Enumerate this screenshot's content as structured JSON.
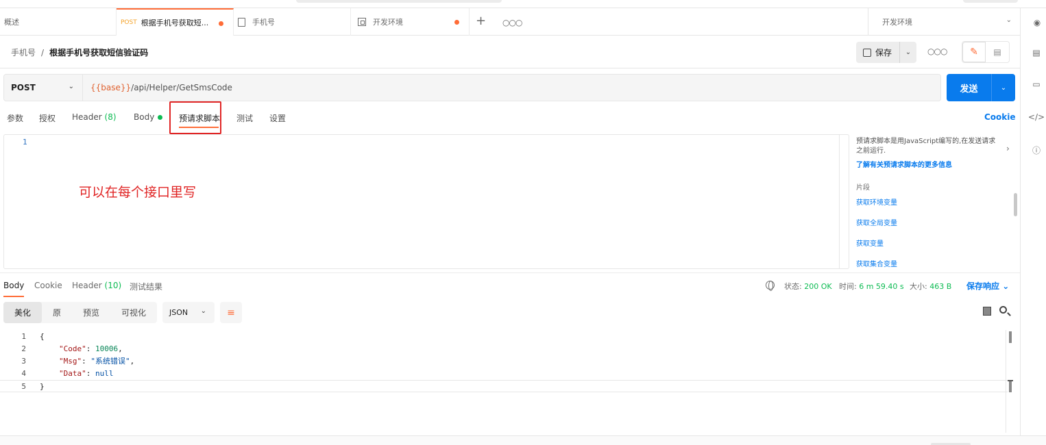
{
  "tabs": [
    {
      "label": "概述"
    },
    {
      "method": "POST",
      "label": "根据手机号获取短...",
      "unsaved": true
    },
    {
      "label": "手机号"
    },
    {
      "label": "开发环境",
      "unsaved": true
    }
  ],
  "environment": {
    "selected": "开发环境"
  },
  "breadcrumb": {
    "parent": "手机号",
    "separator": "/",
    "current": "根据手机号获取短信验证码"
  },
  "toolbar": {
    "save_label": "保存"
  },
  "request": {
    "method": "POST",
    "url_variable": "{{base}}",
    "url_path": "/api/Helper/GetSmsCode",
    "send_label": "发送"
  },
  "request_tabs": {
    "params": "参数",
    "auth": "授权",
    "headers": "Header",
    "headers_count": "(8)",
    "body": "Body",
    "prerequest": "预请求脚本",
    "tests": "测试",
    "settings": "设置",
    "cookie": "Cookie",
    "active": "预请求脚本"
  },
  "editor": {
    "line_numbers": [
      "1"
    ]
  },
  "annotation": {
    "text": "可以在每个接口里写",
    "color": "#e02424"
  },
  "snippets_panel": {
    "description": "预请求脚本是用JavaScript编写的,在发送请求之前运行.",
    "learn_more": "了解有关预请求脚本的更多信息",
    "section_title": "片段",
    "items": [
      "获取环境变量",
      "获取全局变量",
      "获取变量",
      "获取集合变量"
    ]
  },
  "response_tabs": {
    "body": "Body",
    "cookie": "Cookie",
    "headers": "Header",
    "headers_count": "(10)",
    "test_results": "测试结果"
  },
  "response_meta": {
    "status_label": "状态:",
    "status_value": "200 OK",
    "time_label": "时间:",
    "time_value": "6 m 59.40 s",
    "size_label": "大小:",
    "size_value": "463 B",
    "save_response": "保存响应"
  },
  "view_modes": [
    "美化",
    "原",
    "预览",
    "可视化"
  ],
  "format": "JSON",
  "response_code": {
    "line_numbers": [
      "1",
      "2",
      "3",
      "4",
      "5"
    ],
    "open_brace": "{",
    "close_brace": "}",
    "fields": [
      {
        "key": "\"Code\"",
        "value": "10006",
        "suffix": ","
      },
      {
        "key": "\"Msg\"",
        "value": "\"系统错误\"",
        "suffix": ","
      },
      {
        "key": "\"Data\"",
        "value": "null",
        "suffix": ""
      }
    ]
  },
  "colors": {
    "accent": "#ff6c37",
    "primary": "#097bed",
    "success": "#0cbb52",
    "annotation": "#e02424"
  }
}
